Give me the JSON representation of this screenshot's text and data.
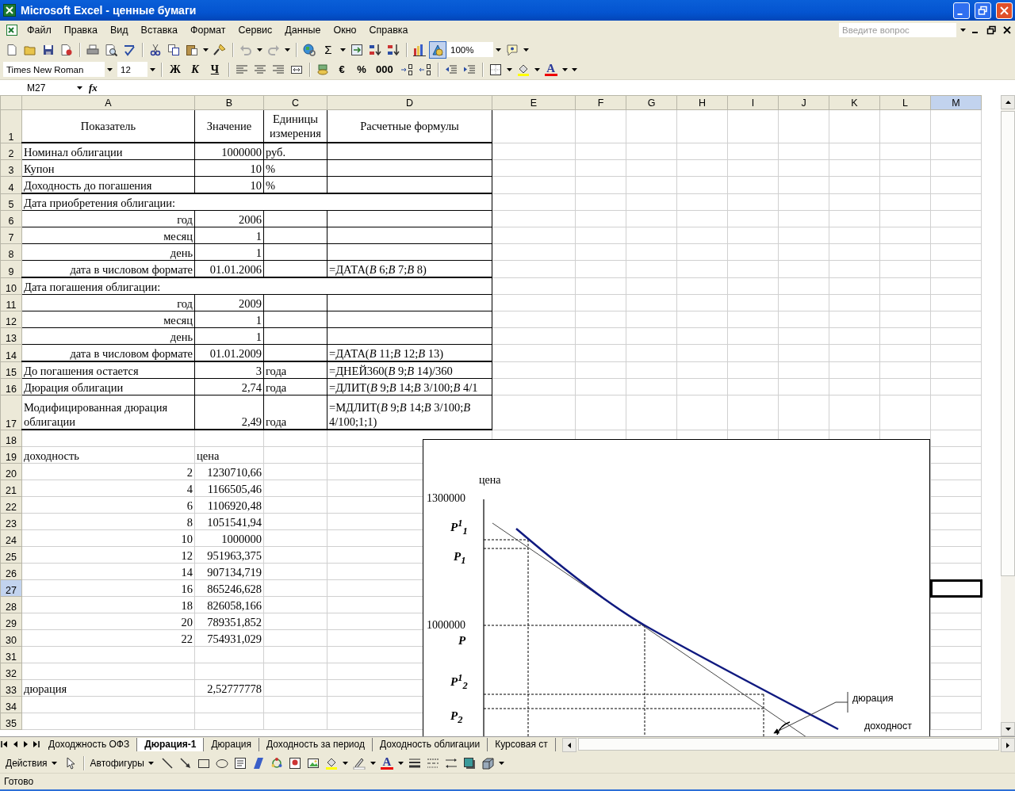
{
  "window": {
    "title": "Microsoft Excel - ценные бумаги"
  },
  "menu": [
    "Файл",
    "Правка",
    "Вид",
    "Вставка",
    "Формат",
    "Сервис",
    "Данные",
    "Окно",
    "Справка"
  ],
  "help_field": {
    "placeholder": "Введите вопрос"
  },
  "standard_toolbar": {
    "sum": "Σ",
    "zoom": "100%",
    "drawing_toggle_pressed": true
  },
  "formatting_toolbar": {
    "font": "Times New Roman",
    "size": "12",
    "style_buttons": [
      {
        "label": "Ж",
        "kind": "bold"
      },
      {
        "label": "К",
        "kind": "italic"
      },
      {
        "label": "Ч",
        "kind": "underline"
      }
    ],
    "number_buttons": [
      "€",
      "%",
      "000"
    ],
    "font_color": "A"
  },
  "formula_bar": {
    "name_box": "M27",
    "function_label": "fx"
  },
  "sheet": {
    "columns": [
      {
        "label": "A",
        "selected": false
      },
      {
        "label": "B",
        "selected": false
      },
      {
        "label": "C",
        "selected": false
      },
      {
        "label": "D",
        "selected": false
      },
      {
        "label": "E",
        "selected": false
      },
      {
        "label": "F",
        "selected": false
      },
      {
        "label": "G",
        "selected": false
      },
      {
        "label": "H",
        "selected": false
      },
      {
        "label": "I",
        "selected": false
      },
      {
        "label": "J",
        "selected": false
      },
      {
        "label": "K",
        "selected": false
      },
      {
        "label": "L",
        "selected": false
      },
      {
        "label": "M",
        "selected": true
      }
    ],
    "rows": [
      {
        "header": "1",
        "selected": false,
        "cells": [
          {
            "text": "Показатель",
            "kind": "heading"
          },
          {
            "text": "Значение",
            "kind": "heading"
          },
          {
            "text": "Единицы измерения",
            "kind": "heading"
          },
          {
            "text": "Расчетные формулы",
            "kind": "heading"
          }
        ]
      },
      {
        "header": "2",
        "selected": false,
        "cells": [
          {
            "text": "Номинал облигации",
            "kind": "text"
          },
          {
            "text": "1000000",
            "kind": "number"
          },
          {
            "text": "руб.",
            "kind": "text"
          }
        ]
      },
      {
        "header": "3",
        "selected": false,
        "cells": [
          {
            "text": "Купон",
            "kind": "text"
          },
          {
            "text": "10",
            "kind": "number"
          },
          {
            "text": "%",
            "kind": "text"
          }
        ]
      },
      {
        "header": "4",
        "selected": false,
        "cells": [
          {
            "text": "Доходность до погашения",
            "kind": "text"
          },
          {
            "text": "10",
            "kind": "number"
          },
          {
            "text": "%",
            "kind": "text"
          }
        ]
      },
      {
        "header": "5",
        "selected": false,
        "cells": [
          {
            "text": "Дата приобретения облигации:",
            "kind": "section"
          }
        ]
      },
      {
        "header": "6",
        "selected": false,
        "cells": [
          {
            "text": "год",
            "kind": "label"
          },
          {
            "text": "2006",
            "kind": "number"
          }
        ]
      },
      {
        "header": "7",
        "selected": false,
        "cells": [
          {
            "text": "месяц",
            "kind": "label"
          },
          {
            "text": "1",
            "kind": "number"
          }
        ]
      },
      {
        "header": "8",
        "selected": false,
        "cells": [
          {
            "text": "день",
            "kind": "label"
          },
          {
            "text": "1",
            "kind": "number"
          }
        ]
      },
      {
        "header": "9",
        "selected": false,
        "cells": [
          {
            "text": "дата в числовом формате",
            "kind": "label"
          },
          {
            "text": "01.01.2006",
            "kind": "number"
          },
          null,
          {
            "text": " =ДАТА(*B* 6;*B* 7;*B* 8)",
            "kind": "text"
          }
        ]
      },
      {
        "header": "10",
        "selected": false,
        "cells": [
          {
            "text": "Дата погашения облигации:",
            "kind": "section"
          }
        ]
      },
      {
        "header": "11",
        "selected": false,
        "cells": [
          {
            "text": "год",
            "kind": "label"
          },
          {
            "text": "2009",
            "kind": "number"
          }
        ]
      },
      {
        "header": "12",
        "selected": false,
        "cells": [
          {
            "text": "месяц",
            "kind": "label"
          },
          {
            "text": "1",
            "kind": "number"
          }
        ]
      },
      {
        "header": "13",
        "selected": false,
        "cells": [
          {
            "text": "день",
            "kind": "label"
          },
          {
            "text": "1",
            "kind": "number"
          }
        ]
      },
      {
        "header": "14",
        "selected": false,
        "cells": [
          {
            "text": "дата в числовом формате",
            "kind": "label"
          },
          {
            "text": "01.01.2009",
            "kind": "number"
          },
          null,
          {
            "text": " =ДАТА(*B* 11;*B* 12;*B* 13)",
            "kind": "text"
          }
        ]
      },
      {
        "header": "15",
        "selected": false,
        "cells": [
          {
            "text": "До погашения остается",
            "kind": "text"
          },
          {
            "text": "3",
            "kind": "number"
          },
          {
            "text": "года",
            "kind": "text"
          },
          {
            "text": " =ДНЕЙ360(*B* 9;*B* 14)/360",
            "kind": "text"
          }
        ]
      },
      {
        "header": "16",
        "selected": false,
        "cells": [
          {
            "text": "Дюрация облигации",
            "kind": "text"
          },
          {
            "text": "2,74",
            "kind": "number"
          },
          {
            "text": "года",
            "kind": "text"
          },
          {
            "text": "=ДЛИТ(*B* 9;*B* 14;*B* 3/100;*B* 4/1",
            "kind": "text"
          }
        ]
      },
      {
        "header": "17",
        "selected": false,
        "cells": [
          {
            "text": "Модифицированная дюрация облигации",
            "kind": "text"
          },
          {
            "text": "2,49",
            "kind": "number"
          },
          {
            "text": "года",
            "kind": "text"
          },
          {
            "text": "=МДЛИТ(*B* 9;*B* 14;*B* 3/100;*B* 4/100;1;1)",
            "kind": "text"
          }
        ]
      },
      {
        "header": "18",
        "selected": false,
        "cells": []
      },
      {
        "header": "19",
        "selected": false,
        "cells": [
          {
            "text": "доходность",
            "kind": "text"
          },
          {
            "text": "цена",
            "kind": "text"
          }
        ]
      },
      {
        "header": "20",
        "selected": false,
        "cells": [
          {
            "text": "2",
            "kind": "number"
          },
          {
            "text": "1230710,66",
            "kind": "number"
          }
        ]
      },
      {
        "header": "21",
        "selected": false,
        "cells": [
          {
            "text": "4",
            "kind": "number"
          },
          {
            "text": "1166505,46",
            "kind": "number"
          }
        ]
      },
      {
        "header": "22",
        "selected": false,
        "cells": [
          {
            "text": "6",
            "kind": "number"
          },
          {
            "text": "1106920,48",
            "kind": "number"
          }
        ]
      },
      {
        "header": "23",
        "selected": false,
        "cells": [
          {
            "text": "8",
            "kind": "number"
          },
          {
            "text": "1051541,94",
            "kind": "number"
          }
        ]
      },
      {
        "header": "24",
        "selected": false,
        "cells": [
          {
            "text": "10",
            "kind": "number"
          },
          {
            "text": "1000000",
            "kind": "number"
          }
        ]
      },
      {
        "header": "25",
        "selected": false,
        "cells": [
          {
            "text": "12",
            "kind": "number"
          },
          {
            "text": "951963,375",
            "kind": "number"
          }
        ]
      },
      {
        "header": "26",
        "selected": false,
        "cells": [
          {
            "text": "14",
            "kind": "number"
          },
          {
            "text": "907134,719",
            "kind": "number"
          }
        ]
      },
      {
        "header": "27",
        "selected": true,
        "cells": [
          {
            "text": "16",
            "kind": "number"
          },
          {
            "text": "865246,628",
            "kind": "number"
          }
        ]
      },
      {
        "header": "28",
        "selected": false,
        "cells": [
          {
            "text": "18",
            "kind": "number"
          },
          {
            "text": "826058,166",
            "kind": "number"
          }
        ]
      },
      {
        "header": "29",
        "selected": false,
        "cells": [
          {
            "text": "20",
            "kind": "number"
          },
          {
            "text": "789351,852",
            "kind": "number"
          }
        ]
      },
      {
        "header": "30",
        "selected": false,
        "cells": [
          {
            "text": "22",
            "kind": "number"
          },
          {
            "text": "754931,029",
            "kind": "number"
          }
        ]
      },
      {
        "header": "31",
        "selected": false,
        "cells": []
      },
      {
        "header": "32",
        "selected": false,
        "cells": []
      },
      {
        "header": "33",
        "selected": false,
        "cells": [
          {
            "text": "дюрация",
            "kind": "text"
          },
          {
            "text": "2,52777778",
            "kind": "number"
          }
        ]
      },
      {
        "header": "34",
        "selected": false,
        "cells": []
      },
      {
        "header": "35",
        "selected": false,
        "cells": []
      }
    ]
  },
  "chart": {
    "y_title": "цена",
    "y_ticks": [
      "1300000",
      "1000000"
    ],
    "price_labels": [
      "*P*$^{1}$$_{1}$",
      "*P*$_{1}$",
      "*P*",
      "*P*$^{1}$$_{2}$",
      "*P*$_{2}$"
    ],
    "callout": "дюрация",
    "x_title": "доходност"
  },
  "sheet_tabs": [
    {
      "label": "Доходжность ОФЗ",
      "selected": false
    },
    {
      "label": "Дюрация-1",
      "selected": true
    },
    {
      "label": "Дюрация",
      "selected": false
    },
    {
      "label": "Доходность за период",
      "selected": false
    },
    {
      "label": "Доходность облигации",
      "selected": false
    },
    {
      "label": "Курсовая ст",
      "selected": false
    }
  ],
  "drawing_toolbar": {
    "actions": "Действия",
    "autoshapes": "Автофигуры",
    "font_color": "A"
  },
  "status_bar": "Готово"
}
